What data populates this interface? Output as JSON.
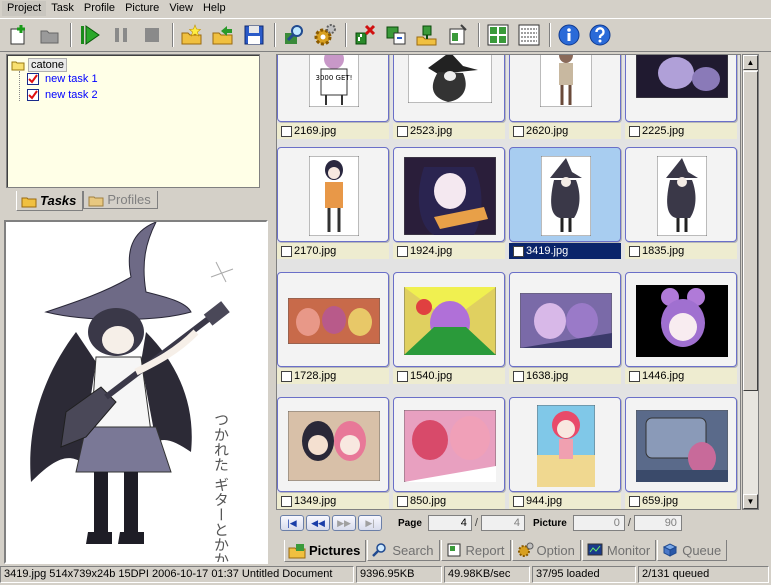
{
  "menu": [
    {
      "label": "Project",
      "accel": "P"
    },
    {
      "label": "Task",
      "accel": "T"
    },
    {
      "label": "Profile",
      "accel": "r"
    },
    {
      "label": "Picture",
      "accel": "i"
    },
    {
      "label": "View",
      "accel": "V"
    },
    {
      "label": "Help",
      "accel": "H"
    }
  ],
  "tree": {
    "root": "catone",
    "children": [
      {
        "label": "new task 1",
        "checked": true
      },
      {
        "label": "new task 2",
        "checked": true
      }
    ]
  },
  "left_tabs": {
    "tasks": "Tasks",
    "profiles": "Profiles"
  },
  "preview_text": "つかれた ギターとかかいりぼ",
  "grid": {
    "rows": [
      [
        "2169.jpg",
        "2523.jpg",
        "2620.jpg",
        "2225.jpg"
      ],
      [
        "2170.jpg",
        "1924.jpg",
        "3419.jpg",
        "1835.jpg"
      ],
      [
        "1728.jpg",
        "1540.jpg",
        "1638.jpg",
        "1446.jpg"
      ],
      [
        "1349.jpg",
        "850.jpg",
        "944.jpg",
        "659.jpg"
      ]
    ],
    "selected": "3419.jpg",
    "thumb_text": "3000 GET!"
  },
  "pager": {
    "page_label": "Page",
    "page_current": "4",
    "page_total": "4",
    "picture_label": "Picture",
    "picture_current": "0",
    "picture_total": "90"
  },
  "bottom_tabs": {
    "pictures": "Pictures",
    "search": "Search",
    "report": "Report",
    "option": "Option",
    "monitor": "Monitor",
    "queue": "Queue"
  },
  "status": {
    "info": "3419.jpg 514x739x24b 15DPI 2006-10-17 01:37 Untitled Document",
    "size": "9396.95KB",
    "speed": "49.98KB/sec",
    "loaded": "37/95 loaded",
    "queued": "2/131 queued"
  },
  "colors": {
    "face": "#d4d0c8",
    "selection": "#0a246a",
    "frame_border": "#6a6fc8",
    "tree_bg": "#ffffe7"
  }
}
